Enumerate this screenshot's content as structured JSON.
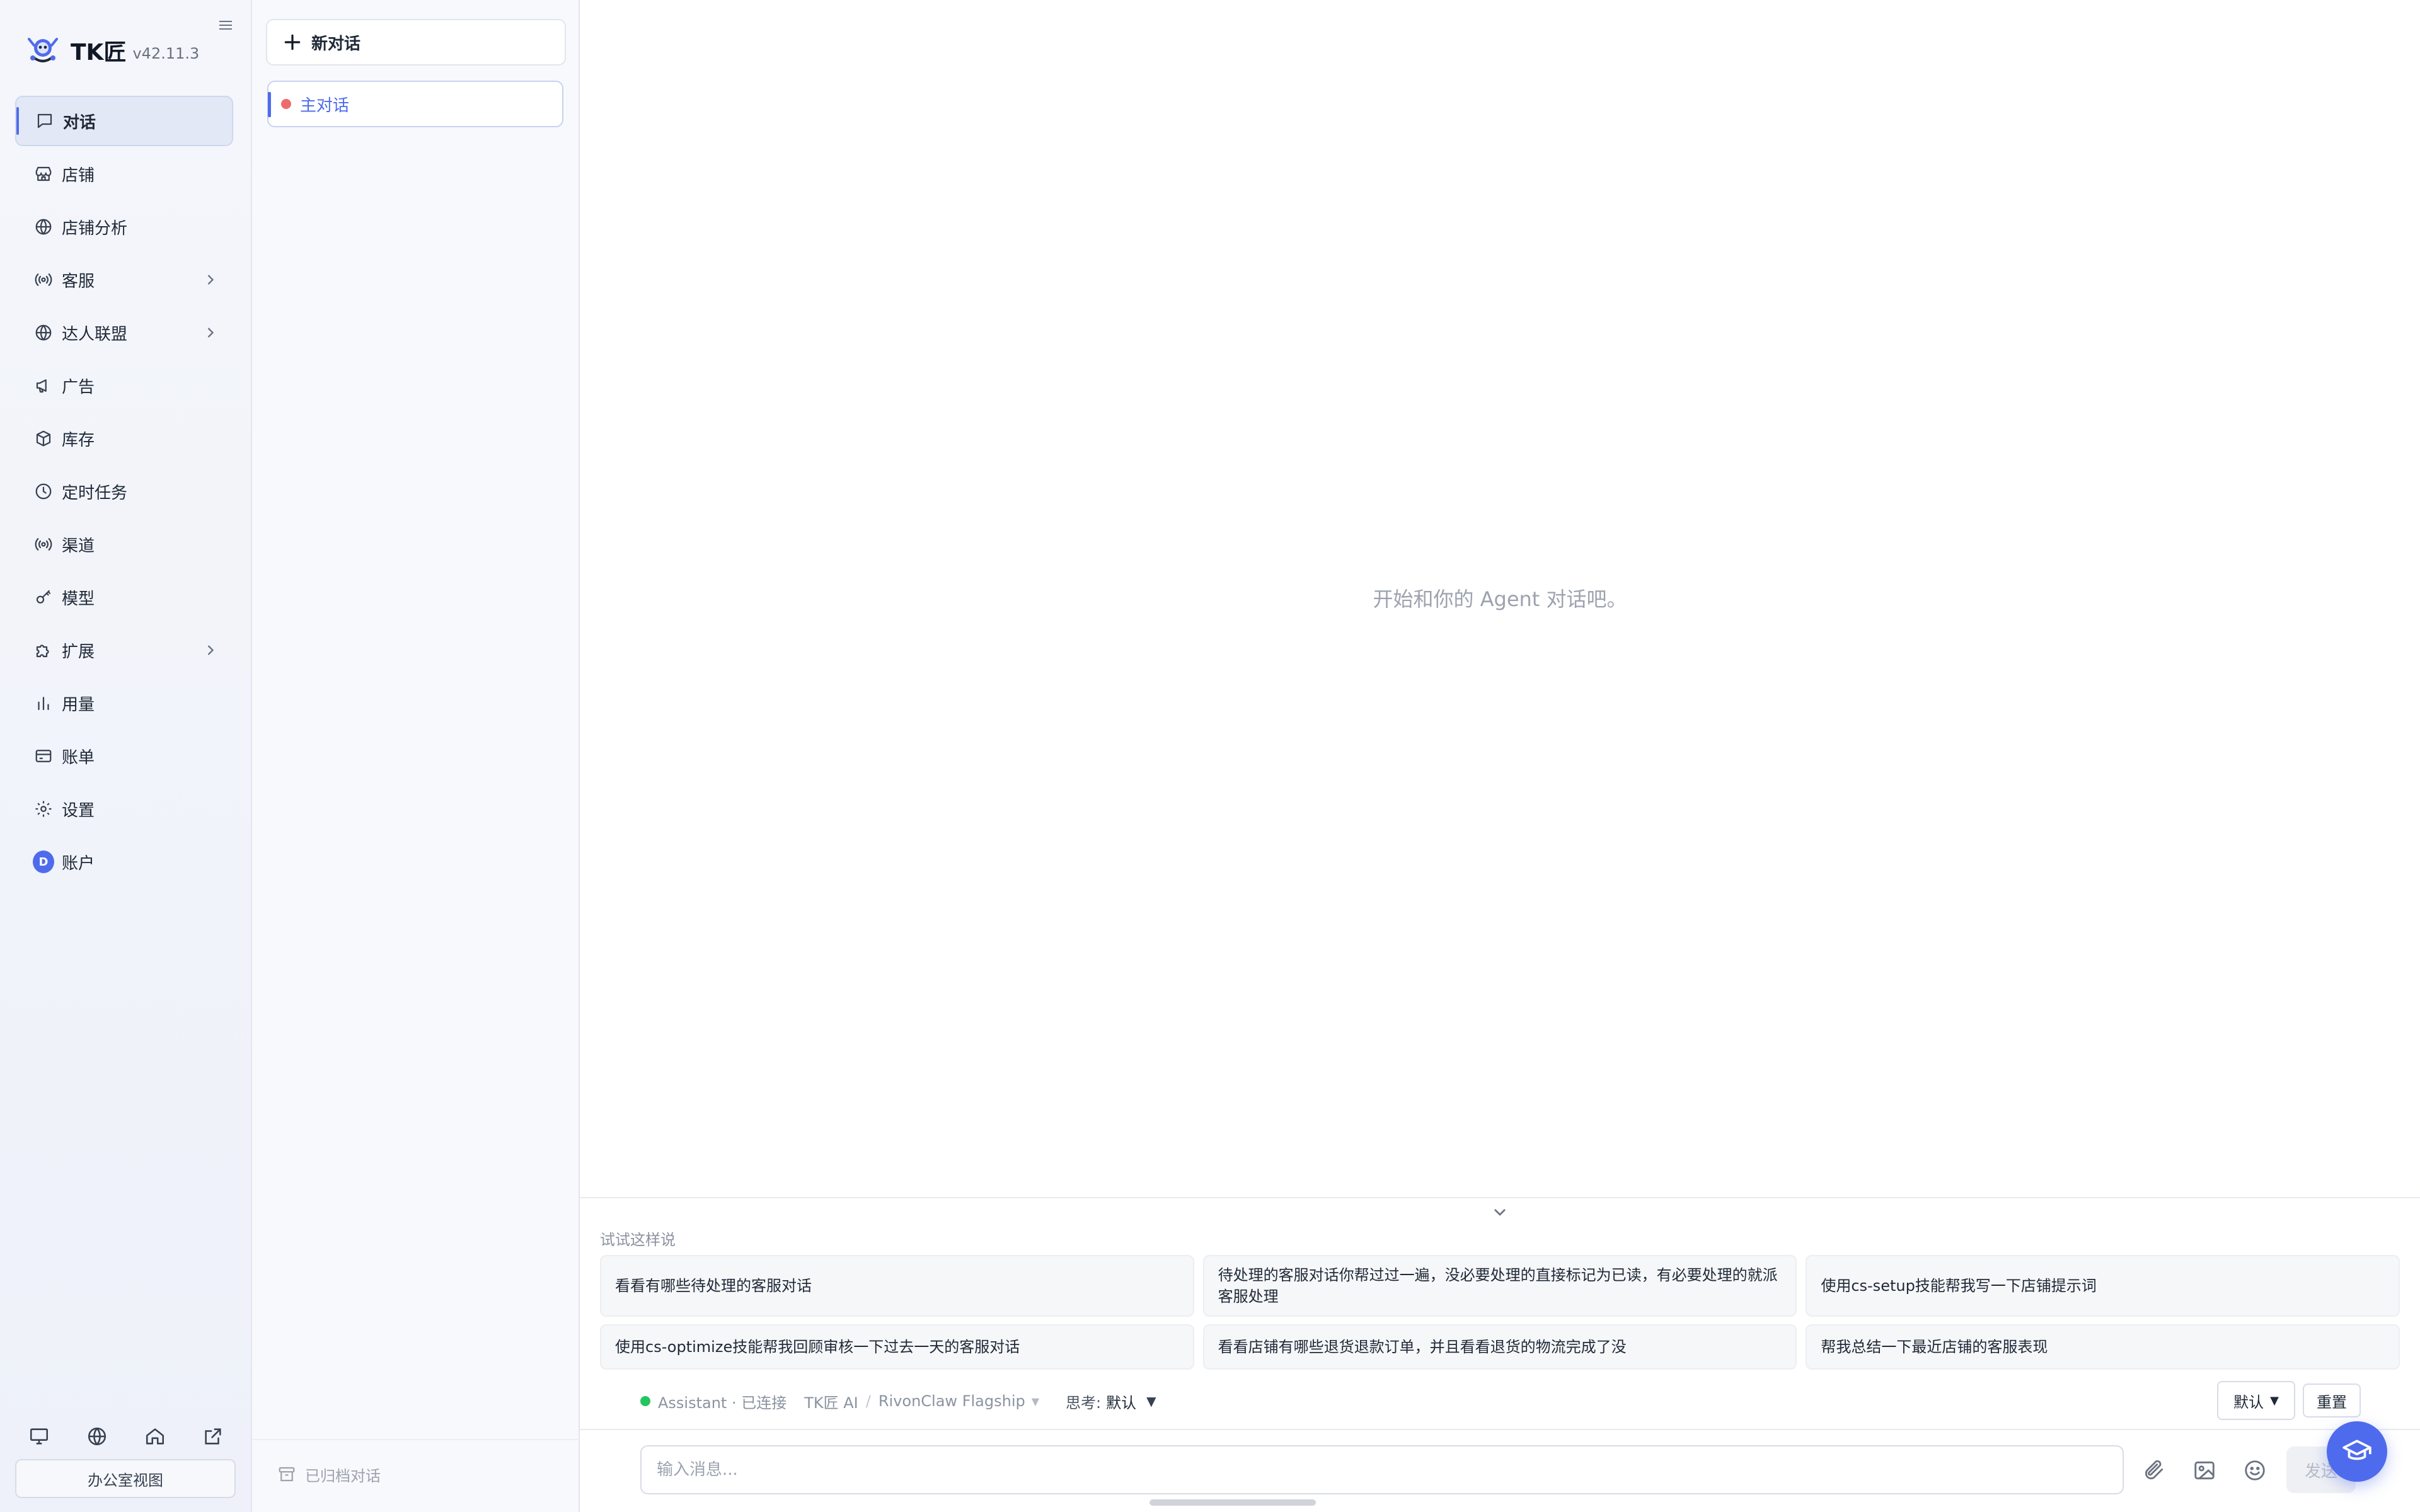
{
  "brand": {
    "name": "TK匠",
    "version": "v42.11.3"
  },
  "sidebar": {
    "items": [
      {
        "label": "对话",
        "icon": "chat-bubble-icon"
      },
      {
        "label": "店铺",
        "icon": "store-icon"
      },
      {
        "label": "店铺分析",
        "icon": "globe-icon"
      },
      {
        "label": "客服",
        "icon": "broadcast-icon"
      },
      {
        "label": "达人联盟",
        "icon": "globe-icon"
      },
      {
        "label": "广告",
        "icon": "megaphone-icon"
      },
      {
        "label": "库存",
        "icon": "box-icon"
      },
      {
        "label": "定时任务",
        "icon": "clock-icon"
      },
      {
        "label": "渠道",
        "icon": "broadcast-icon"
      },
      {
        "label": "模型",
        "icon": "key-icon"
      },
      {
        "label": "扩展",
        "icon": "puzzle-icon"
      },
      {
        "label": "用量",
        "icon": "bar-chart-icon"
      },
      {
        "label": "账单",
        "icon": "credit-card-icon"
      },
      {
        "label": "设置",
        "icon": "gear-icon"
      },
      {
        "label": "账户",
        "icon": "avatar-icon",
        "avatar_letter": "D"
      }
    ],
    "active_index": 0,
    "office_view_label": "办公室视图"
  },
  "conversations": {
    "new_chat_label": "新对话",
    "items": [
      {
        "label": "主对话"
      }
    ],
    "archived_label": "已归档对话"
  },
  "main": {
    "empty_hint": "开始和你的 Agent 对话吧。",
    "suggestions_title": "试试这样说",
    "suggestions": [
      "看看有哪些待处理的客服对话",
      "待处理的客服对话你帮过过一遍，没必要处理的直接标记为已读，有必要处理的就派客服处理",
      "使用cs-setup技能帮我写一下店铺提示词",
      "使用cs-optimize技能帮我回顾审核一下过去一天的客服对话",
      "看看店铺有哪些退货退款订单，并且看看退货的物流完成了没",
      "帮我总结一下最近店铺的客服表现"
    ],
    "status": {
      "agent": "Assistant · 已连接",
      "provider": "TK匠 AI",
      "separator": "/",
      "model": "RivonClaw Flagship",
      "think_label": "思考:",
      "think_value": "默认"
    },
    "default_select": "默认",
    "reset_label": "重置",
    "input_placeholder": "输入消息...",
    "input_value": "",
    "send_label": "发送"
  },
  "colors": {
    "accent": "#4f6bed",
    "connected": "#22c55e",
    "conversation_dot": "#ef6b6b"
  }
}
